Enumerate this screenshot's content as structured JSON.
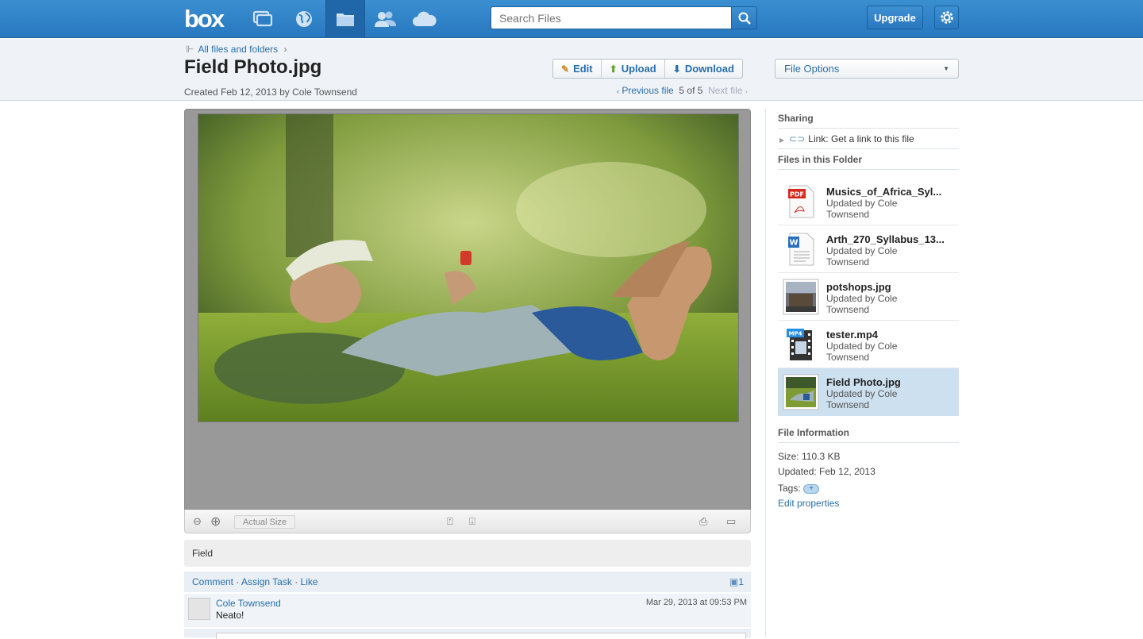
{
  "app": {
    "logo": "box"
  },
  "topbar": {
    "nav": [
      {
        "icon": "updates-icon"
      },
      {
        "icon": "globe-icon"
      },
      {
        "icon": "folder-icon"
      },
      {
        "icon": "people-icon"
      },
      {
        "icon": "cloud-icon"
      }
    ],
    "search_placeholder": "Search Files",
    "upgrade_label": "Upgrade"
  },
  "header": {
    "breadcrumb": "All files and folders",
    "breadcrumb_sep": "›",
    "title": "Field Photo.jpg",
    "created": "Created Feb 12, 2013 by Cole Townsend",
    "edit_label": "Edit",
    "upload_label": "Upload",
    "download_label": "Download",
    "file_options_label": "File Options",
    "prev_file": "Previous file",
    "position": "5 of 5",
    "next_file": "Next file"
  },
  "viewer": {
    "actual_size": "Actual Size",
    "description": "Field"
  },
  "actions": {
    "comment": "Comment",
    "sep1": "·",
    "assign_task": "Assign Task",
    "sep2": "·",
    "like": "Like",
    "comment_count": "1"
  },
  "comments": [
    {
      "author": "Cole Townsend",
      "text": "Neato!",
      "date": "Mar 29, 2013 at 09:53 PM"
    }
  ],
  "sidebar": {
    "sharing_title": "Sharing",
    "link_label": "Link:",
    "link_text": "Get a link to this file",
    "folder_title": "Files in this Folder",
    "files": [
      {
        "name": "Musics_of_Africa_Syl...",
        "line1": "Updated by Cole",
        "line2": "Townsend",
        "icon": "pdf-file-icon",
        "badge": "PDF"
      },
      {
        "name": "Arth_270_Syllabus_13...",
        "line1": "Updated by Cole",
        "line2": "Townsend",
        "icon": "word-file-icon",
        "badge": "W"
      },
      {
        "name": "potshops.jpg",
        "line1": "Updated by Cole",
        "line2": "Townsend",
        "icon": "image-thumbnail-icon",
        "badge": ""
      },
      {
        "name": "tester.mp4",
        "line1": "Updated by Cole",
        "line2": "Townsend",
        "icon": "video-file-icon",
        "badge": "MP4"
      },
      {
        "name": "Field Photo.jpg",
        "line1": "Updated by Cole",
        "line2": "Townsend",
        "icon": "image-thumbnail-icon",
        "badge": ""
      }
    ],
    "info_title": "File Information",
    "size": "Size: 110.3 KB",
    "updated": "Updated: Feb 12, 2013",
    "tags_label": "Tags:",
    "edit_properties": "Edit properties"
  },
  "colors": {
    "topbar": "#2d7fc4",
    "link": "#2a6ea8",
    "selected": "#cde0ef"
  }
}
